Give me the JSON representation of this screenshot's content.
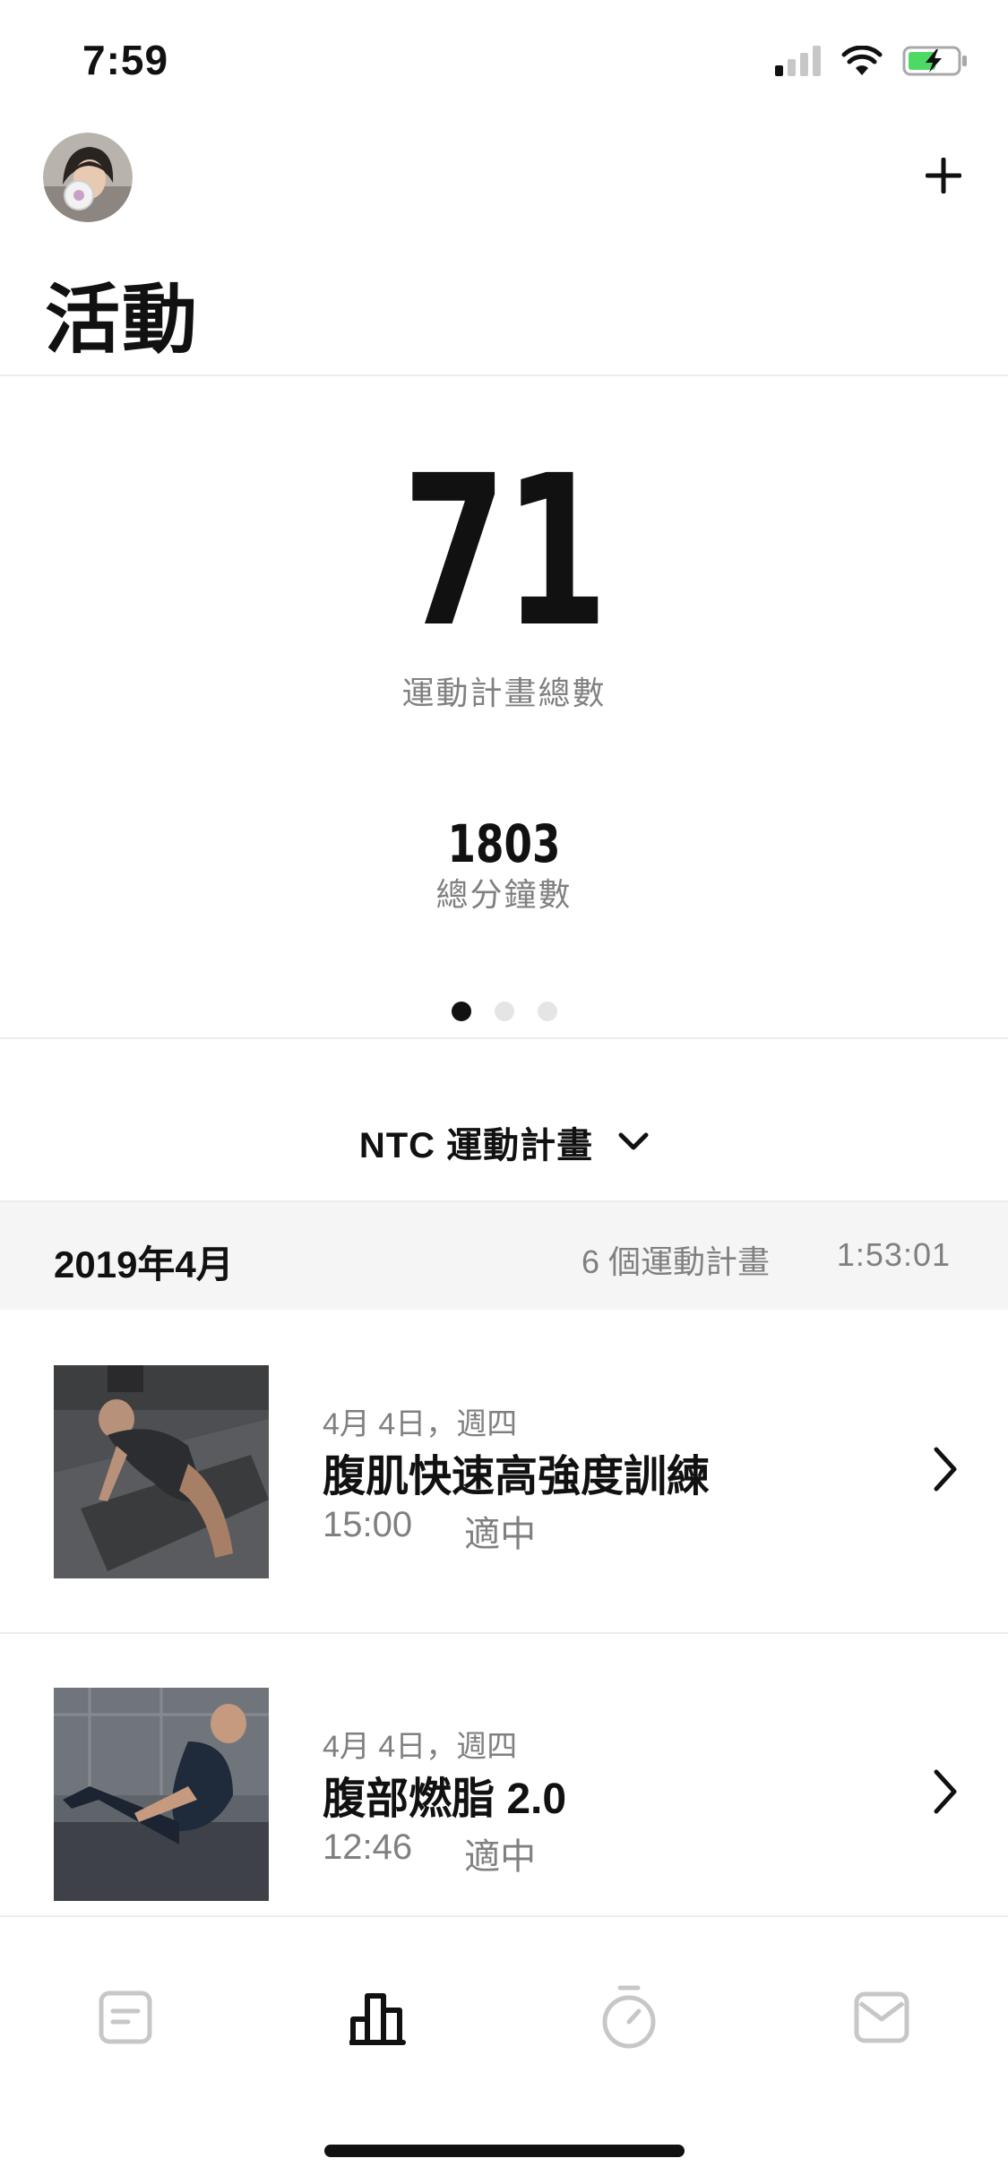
{
  "status_bar": {
    "time": "7:59",
    "icons": [
      "cellular-signal-icon",
      "wifi-icon",
      "battery-charging-icon"
    ]
  },
  "header": {
    "title": "活動",
    "add_icon": "plus-icon",
    "avatar": "user-avatar"
  },
  "summary": {
    "total_workouts": "71",
    "total_workouts_label": "運動計畫總數",
    "total_minutes": "1803",
    "total_minutes_label": "總分鐘數",
    "page_dots": 3,
    "active_dot": 0
  },
  "filter": {
    "label": "NTC 運動計畫",
    "icon": "chevron-down-icon"
  },
  "month": {
    "title": "2019年4月",
    "count": "6 個運動計畫",
    "duration": "1:53:01"
  },
  "workouts": [
    {
      "date": "4月 4日，週四",
      "title": "腹肌快速高強度訓練",
      "duration": "15:00",
      "level": "適中"
    },
    {
      "date": "4月 4日，週四",
      "title": "腹部燃脂 2.0",
      "duration": "12:46",
      "level": "適中"
    }
  ],
  "tabbar": {
    "tabs": [
      "feed-icon",
      "activity-icon",
      "stopwatch-icon",
      "inbox-icon"
    ],
    "active": "activity-icon"
  },
  "colors": {
    "text": "#111111",
    "muted": "#808080",
    "divider": "#ececec",
    "month_bar_bg": "#f5f5f5",
    "battery_green": "#4cd964",
    "inactive_tab": "#c7c7c7"
  }
}
